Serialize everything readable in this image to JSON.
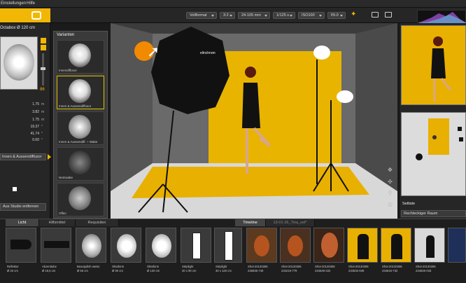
{
  "menu": {
    "settings": "Einstellungen",
    "help": "Hilfe"
  },
  "toolbar": {
    "format": "Vollformat",
    "ratio": "3:2",
    "lens": "24-105 mm",
    "shutter": "1/125 s",
    "iso": "ISO100",
    "aperture": "f/9.0"
  },
  "left": {
    "title": "Octabox Ø 120 cm",
    "slider_value": "86",
    "rows": [
      {
        "value": "1.75",
        "unit": "m"
      },
      {
        "value": "3.82",
        "unit": "m"
      },
      {
        "value": "1.75",
        "unit": "m"
      },
      {
        "value": "19.37",
        "unit": "°"
      },
      {
        "value": "41.74",
        "unit": "°"
      },
      {
        "value": "0.00",
        "unit": "°"
      }
    ],
    "variant_select": "Innen & Aussendiffusor",
    "remove_button": "Aus Studio entfernen"
  },
  "variants": {
    "title": "Varianten",
    "items": [
      {
        "label": "Innendiffusor"
      },
      {
        "label": "Innen & Aussendiffusor"
      },
      {
        "label": "Innen & Aussendiff. + Wabe"
      },
      {
        "label": "Netzwabe"
      },
      {
        "label": "Offen"
      }
    ]
  },
  "studio": {
    "brand_logo": "elinchrom"
  },
  "right": {
    "set_title": "Setliste",
    "room": "Rechteckiger Raum"
  },
  "bottom": {
    "tabs": {
      "light": "Licht",
      "tools": "Hilfsmittel",
      "props": "Requisiten",
      "timeline": "Timeline",
      "timeline_name": "13-01-26_Tina_set*"
    },
    "equipment": [
      {
        "name": "Reflektor",
        "size": "Ø 34 cm"
      },
      {
        "name": "Akzenttube",
        "size": "Ø 16,5 cm"
      },
      {
        "name": "Beautydish weiss",
        "size": "Ø 56 cm"
      },
      {
        "name": "Oktaform",
        "size": "Ø 90 cm"
      },
      {
        "name": "Oktaform",
        "size": "Ø 120 cm"
      },
      {
        "name": "Striplight",
        "size": "30 x 90 cm"
      },
      {
        "name": "Striplight",
        "size": "30 x 120 cm"
      }
    ],
    "shots": [
      {
        "name": "Shot-20130306",
        "id": "235836-740"
      },
      {
        "name": "Shot-20130306",
        "id": "234219-779"
      },
      {
        "name": "Shot-20130306",
        "id": "234529-222"
      },
      {
        "name": "Shot-20130306",
        "id": "234532-849"
      },
      {
        "name": "Shot-20130306",
        "id": "234616-732"
      },
      {
        "name": "Shot-20130306",
        "id": "234826-033"
      }
    ]
  },
  "colors": {
    "accent": "#f2b705",
    "panel": "#262626",
    "floor": "#e8b000"
  }
}
